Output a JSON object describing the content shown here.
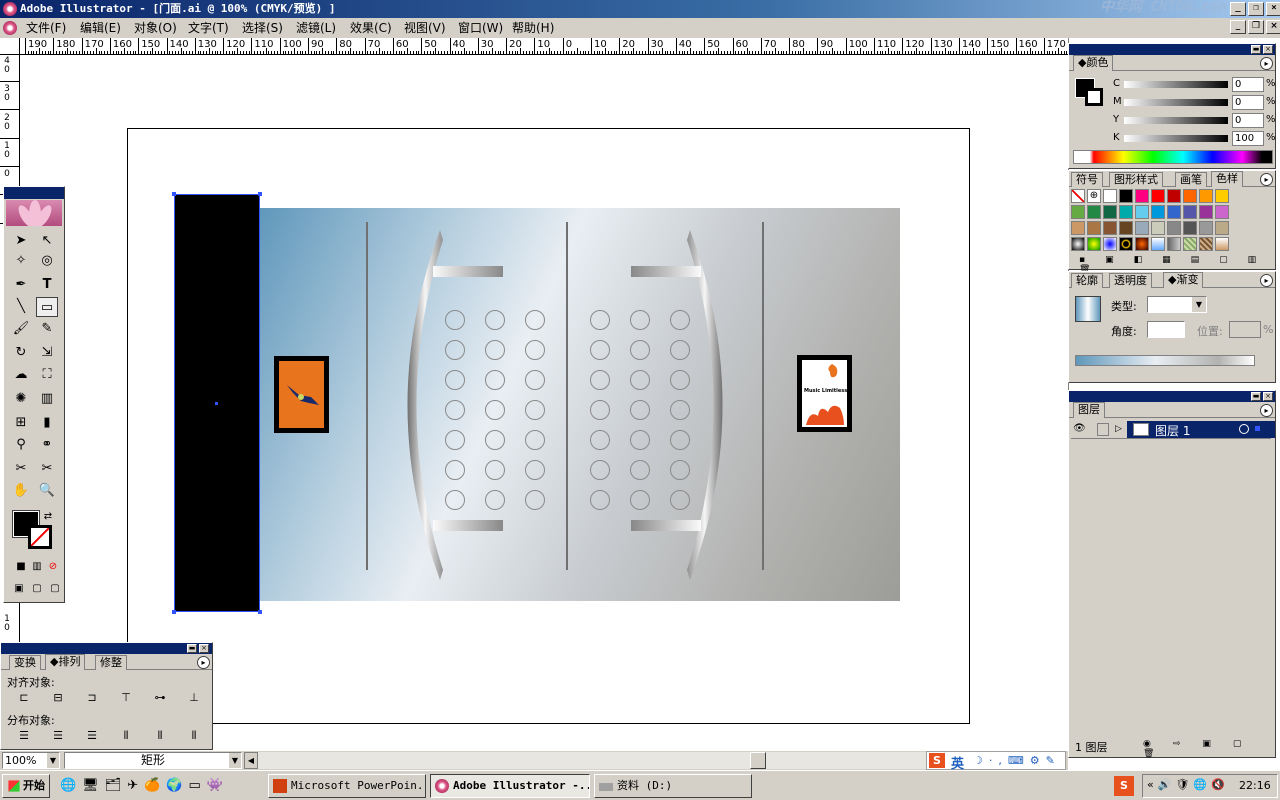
{
  "window": {
    "title": "Adobe Illustrator - [门面.ai @ 100% (CMYK/预览) ]",
    "minimize": "_",
    "restore": "❐",
    "close": "×",
    "watermark": "中华网 CNTOW.com"
  },
  "menu": {
    "items": [
      "文件(F)",
      "编辑(E)",
      "对象(O)",
      "文字(T)",
      "选择(S)",
      "滤镜(L)",
      "效果(C)",
      "视图(V)",
      "窗口(W)",
      "帮助(H)"
    ]
  },
  "ruler": {
    "h_labels": [
      "190",
      "180",
      "170",
      "160",
      "150",
      "140",
      "130",
      "120",
      "110",
      "100",
      "90",
      "80",
      "70",
      "60",
      "50",
      "40",
      "30",
      "20",
      "10",
      "0",
      "10",
      "20",
      "30",
      "40",
      "50",
      "60",
      "70",
      "80",
      "90",
      "100",
      "110",
      "120",
      "130",
      "140",
      "150",
      "160",
      "170"
    ],
    "v_labels": [
      "40",
      "30",
      "20",
      "10",
      "0",
      "10"
    ]
  },
  "canvas": {
    "poster2_text": "Music Limitless"
  },
  "color_panel": {
    "tab": "颜色",
    "channels": [
      {
        "label": "C",
        "value": "0"
      },
      {
        "label": "M",
        "value": "0"
      },
      {
        "label": "Y",
        "value": "0"
      },
      {
        "label": "K",
        "value": "100"
      }
    ],
    "unit": "%"
  },
  "swatch_panel": {
    "tabs": [
      "符号",
      "图形样式",
      "画笔",
      "色样"
    ],
    "colors": [
      [
        "#ffffff",
        "#000000",
        "#ff0080",
        "#ff0000",
        "#c00000",
        "#ff6600",
        "#ff9900",
        "#ffcc00",
        "#ffff00",
        "#99cc33"
      ],
      [
        "#66aa44",
        "#228844",
        "#116644",
        "#00aaaa",
        "#66ccee",
        "#0099dd",
        "#3366cc",
        "#5555aa",
        "#993399",
        "#cc66cc"
      ],
      [
        "#cc9966",
        "#aa7744",
        "#885533",
        "#664422",
        "#99aabb",
        "#ccccbb",
        "#888888",
        "#555555",
        "#999999",
        "#bbaa88"
      ]
    ]
  },
  "gradient_panel": {
    "tabs": [
      "轮廓",
      "透明度",
      "渐变"
    ],
    "type_label": "类型:",
    "angle_label": "角度:",
    "position_label": "位置:",
    "unit": "%"
  },
  "layers_panel": {
    "tab": "图层",
    "layer_name": "图层 1",
    "footer": "1 图层"
  },
  "align_panel": {
    "tabs": [
      "变换",
      "排列",
      "修整"
    ],
    "align_label": "对齐对象:",
    "distribute_label": "分布对象:"
  },
  "status": {
    "zoom": "100%",
    "tool_name": "矩形"
  },
  "ime": {
    "label": "英"
  },
  "taskbar": {
    "start": "开始",
    "tasks": [
      "Microsoft PowerPoin...",
      "Adobe Illustrator -...",
      "资料 (D:)"
    ],
    "clock": "22:16"
  }
}
